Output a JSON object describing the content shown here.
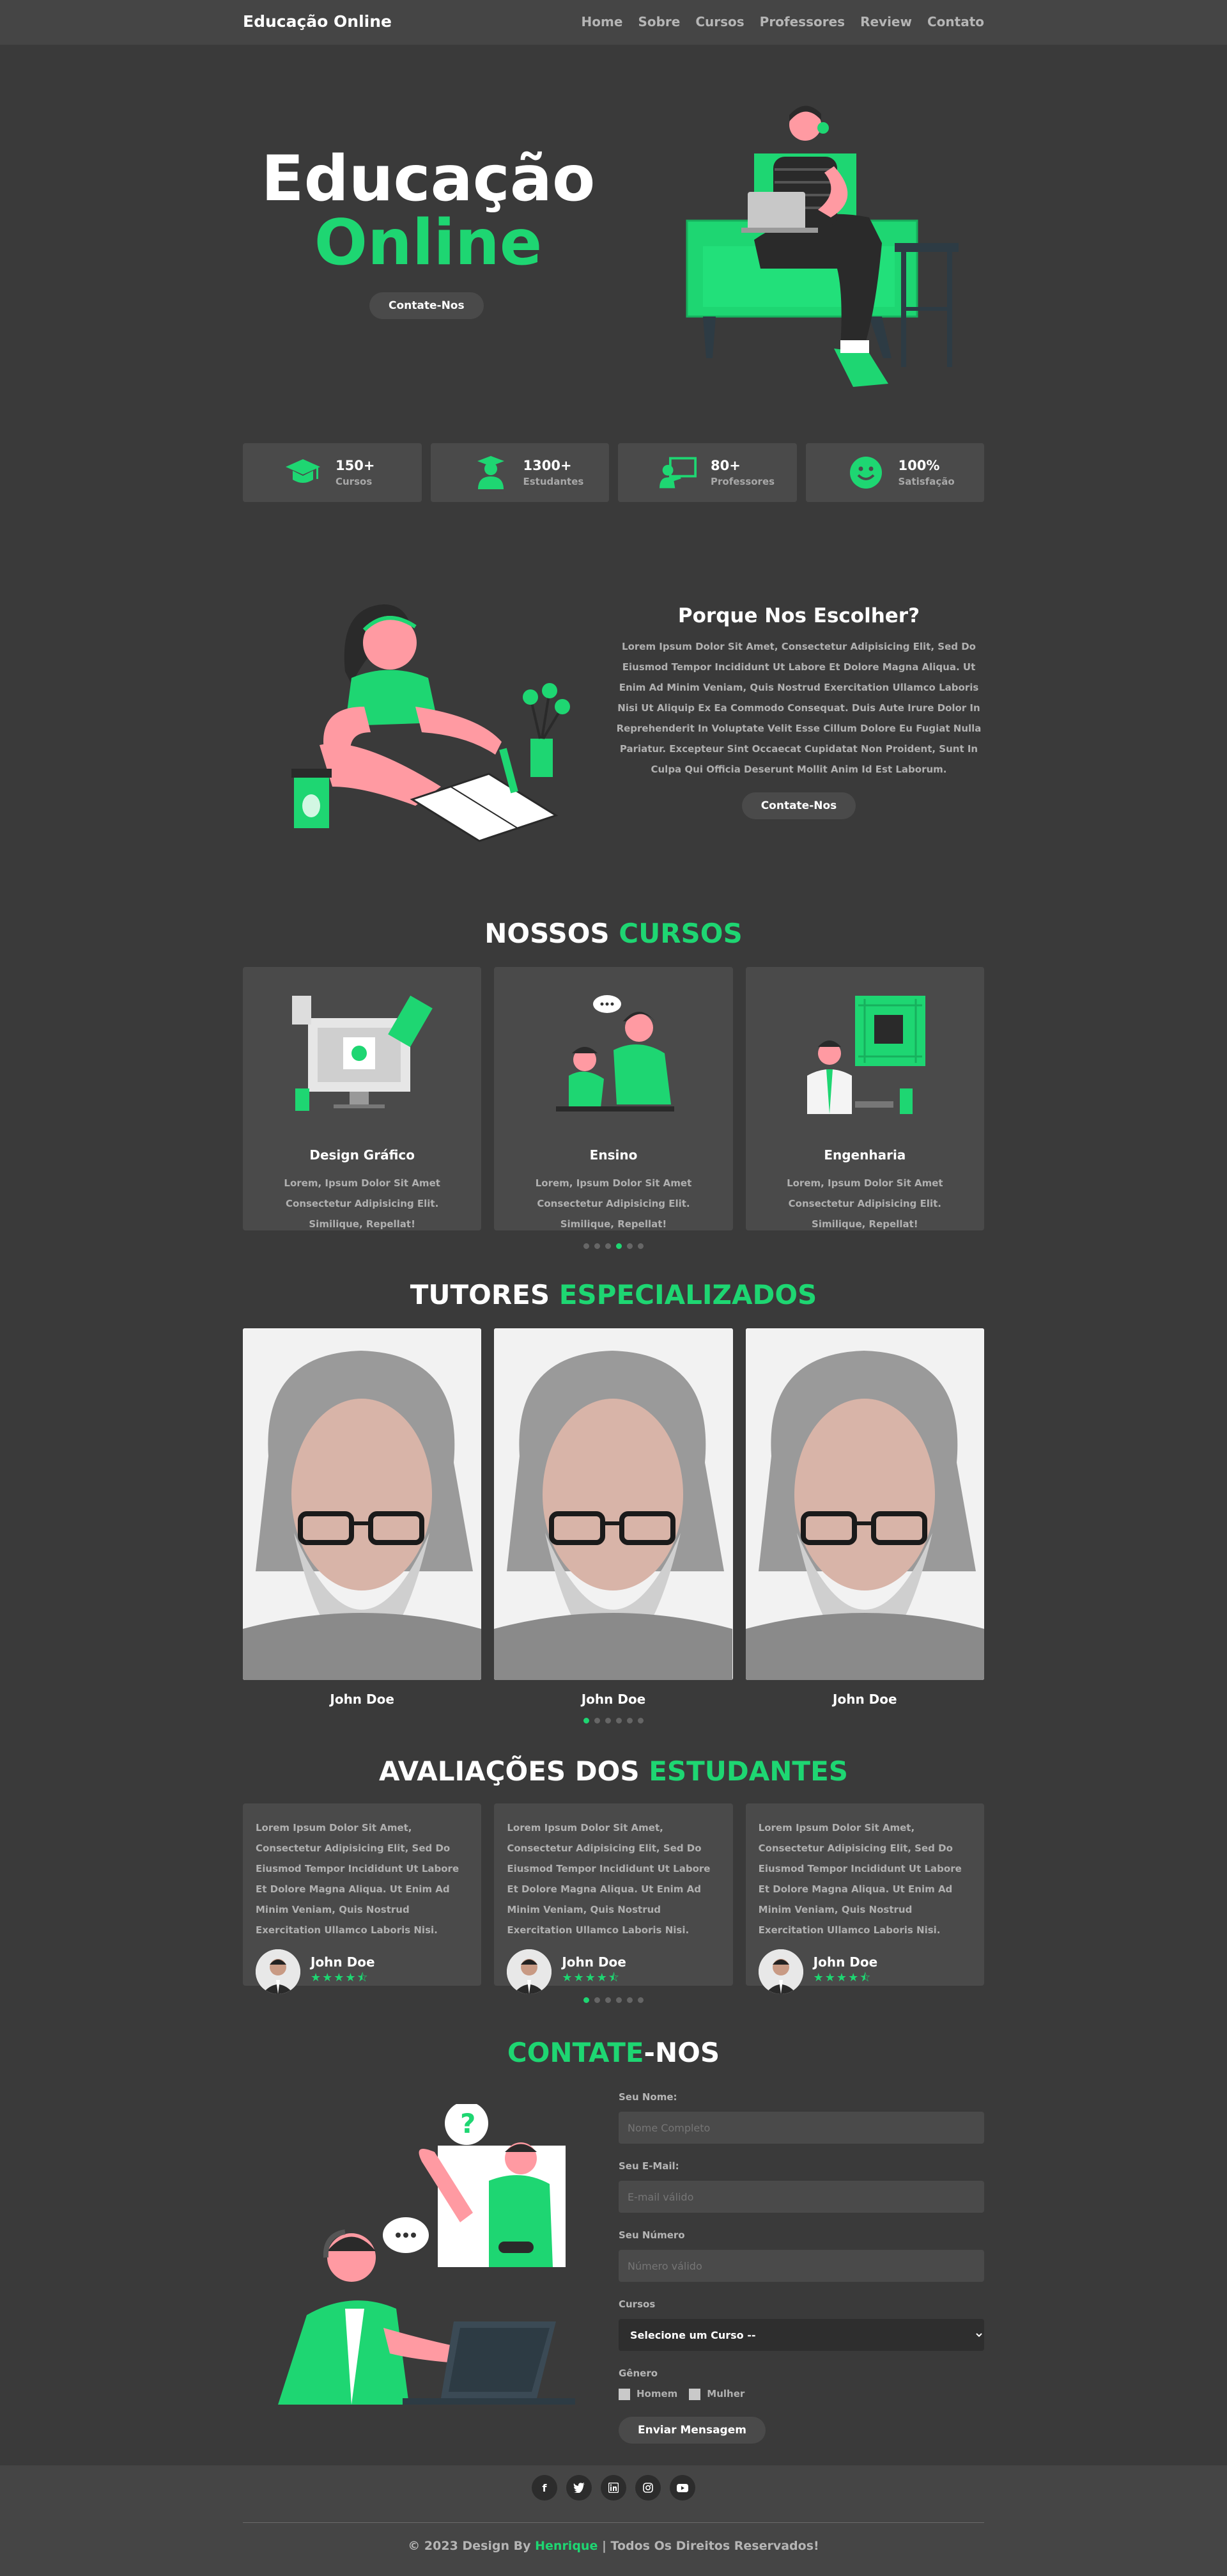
{
  "nav": {
    "brand": "Educação Online",
    "items": [
      "Home",
      "Sobre",
      "Cursos",
      "Professores",
      "Review",
      "Contato"
    ]
  },
  "hero": {
    "title_line1": "Educação",
    "title_line2": "Online",
    "button": "Contate-Nos"
  },
  "stats": [
    {
      "value": "150+",
      "label": "Cursos",
      "icon": "graduation-cap-icon"
    },
    {
      "value": "1300+",
      "label": "Estudantes",
      "icon": "student-icon"
    },
    {
      "value": "80+",
      "label": "Professores",
      "icon": "teacher-icon"
    },
    {
      "value": "100%",
      "label": "Satisfação",
      "icon": "smile-icon"
    }
  ],
  "why": {
    "title": "Porque Nos Escolher?",
    "text": "Lorem Ipsum Dolor Sit Amet, Consectetur Adipisicing Elit, Sed Do Eiusmod Tempor Incididunt Ut Labore Et Dolore Magna Aliqua. Ut Enim Ad Minim Veniam, Quis Nostrud Exercitation Ullamco Laboris Nisi Ut Aliquip Ex Ea Commodo Consequat. Duis Aute Irure Dolor In Reprehenderit In Voluptate Velit Esse Cillum Dolore Eu Fugiat Nulla Pariatur. Excepteur Sint Occaecat Cupidatat Non Proident, Sunt In Culpa Qui Officia Deserunt Mollit Anim Id Est Laborum.",
    "button": "Contate-Nos"
  },
  "courses": {
    "title_a": "NOSSOS ",
    "title_b": "CURSOS",
    "items": [
      {
        "name": "Design Gráfico",
        "desc": "Lorem, Ipsum Dolor Sit Amet Consectetur Adipisicing Elit. Similique, Repellat!"
      },
      {
        "name": "Ensino",
        "desc": "Lorem, Ipsum Dolor Sit Amet Consectetur Adipisicing Elit. Similique, Repellat!"
      },
      {
        "name": "Engenharia",
        "desc": "Lorem, Ipsum Dolor Sit Amet Consectetur Adipisicing Elit. Similique, Repellat!"
      }
    ]
  },
  "tutors": {
    "title_a": "TUTORES ",
    "title_b": "ESPECIALIZADOS",
    "items": [
      {
        "name": "John Doe"
      },
      {
        "name": "John Doe"
      },
      {
        "name": "John Doe"
      }
    ]
  },
  "reviews": {
    "title_a": "AVALIAÇÕES DOS ",
    "title_b": "ESTUDANTES",
    "items": [
      {
        "text": "Lorem Ipsum Dolor Sit Amet, Consectetur Adipisicing Elit, Sed Do Eiusmod Tempor Incididunt Ut Labore Et Dolore Magna Aliqua. Ut Enim Ad Minim Veniam, Quis Nostrud Exercitation Ullamco Laboris Nisi.",
        "name": "John Doe",
        "rating": 4.5
      },
      {
        "text": "Lorem Ipsum Dolor Sit Amet, Consectetur Adipisicing Elit, Sed Do Eiusmod Tempor Incididunt Ut Labore Et Dolore Magna Aliqua. Ut Enim Ad Minim Veniam, Quis Nostrud Exercitation Ullamco Laboris Nisi.",
        "name": "John Doe",
        "rating": 4.5
      },
      {
        "text": "Lorem Ipsum Dolor Sit Amet, Consectetur Adipisicing Elit, Sed Do Eiusmod Tempor Incididunt Ut Labore Et Dolore Magna Aliqua. Ut Enim Ad Minim Veniam, Quis Nostrud Exercitation Ullamco Laboris Nisi.",
        "name": "John Doe",
        "rating": 4.5
      }
    ]
  },
  "contact": {
    "title_a": "CONTATE",
    "title_b": "-NOS",
    "name_label": "Seu Nome:",
    "name_placeholder": "Nome Completo",
    "email_label": "Seu E-Mail:",
    "email_placeholder": "E-mail válido",
    "phone_label": "Seu Número",
    "phone_placeholder": "Número válido",
    "course_label": "Cursos",
    "course_selected": "Selecione um Curso --",
    "gender_label": "Gênero",
    "gender_male": "Homem",
    "gender_female": "Mulher",
    "submit": "Enviar Mensagem"
  },
  "footer": {
    "socials": [
      "facebook-icon",
      "twitter-icon",
      "linkedin-icon",
      "instagram-icon",
      "youtube-icon"
    ],
    "copy_prefix": "© 2023 Design By ",
    "copy_author": "Henrique",
    "copy_suffix": " | Todos Os Direitos Reservados!"
  },
  "colors": {
    "accent": "#1ed672",
    "background": "#3a3a3a",
    "panel": "#4a4a4a"
  },
  "carousel": {
    "courses_active": 4,
    "tutors_active": 1,
    "reviews_active": 1
  }
}
